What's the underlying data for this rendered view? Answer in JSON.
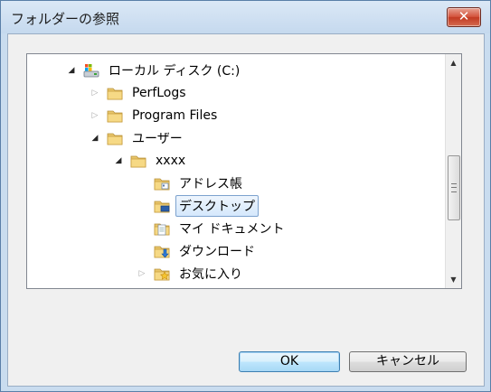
{
  "window": {
    "title": "フォルダーの参照",
    "close_label": "✕"
  },
  "tree": {
    "items": [
      {
        "label": "ローカル ディスク (C:)",
        "icon": "drive-icon",
        "state": "expanded",
        "level": 0
      },
      {
        "label": "PerfLogs",
        "icon": "folder-icon",
        "state": "collapsed",
        "level": 1
      },
      {
        "label": "Program Files",
        "icon": "folder-icon",
        "state": "collapsed",
        "level": 1
      },
      {
        "label": "ユーザー",
        "icon": "folder-icon",
        "state": "expanded",
        "level": 1
      },
      {
        "label": "xxxx",
        "icon": "folder-icon",
        "state": "expanded",
        "level": 2
      },
      {
        "label": "アドレス帳",
        "icon": "contacts-folder-icon",
        "state": "none",
        "level": 3
      },
      {
        "label": "デスクトップ",
        "icon": "desktop-folder-icon",
        "state": "none",
        "level": 3,
        "selected": true
      },
      {
        "label": "マイ ドキュメント",
        "icon": "documents-folder-icon",
        "state": "none",
        "level": 3
      },
      {
        "label": "ダウンロード",
        "icon": "downloads-folder-icon",
        "state": "none",
        "level": 3
      },
      {
        "label": "お気に入り",
        "icon": "favorites-folder-icon",
        "state": "collapsed",
        "level": 3
      }
    ]
  },
  "buttons": {
    "ok": "OK",
    "cancel": "キャンセル"
  },
  "colors": {
    "frame": "#c9dcef",
    "selection_border": "#7da2ce",
    "close_red": "#c23a22"
  }
}
